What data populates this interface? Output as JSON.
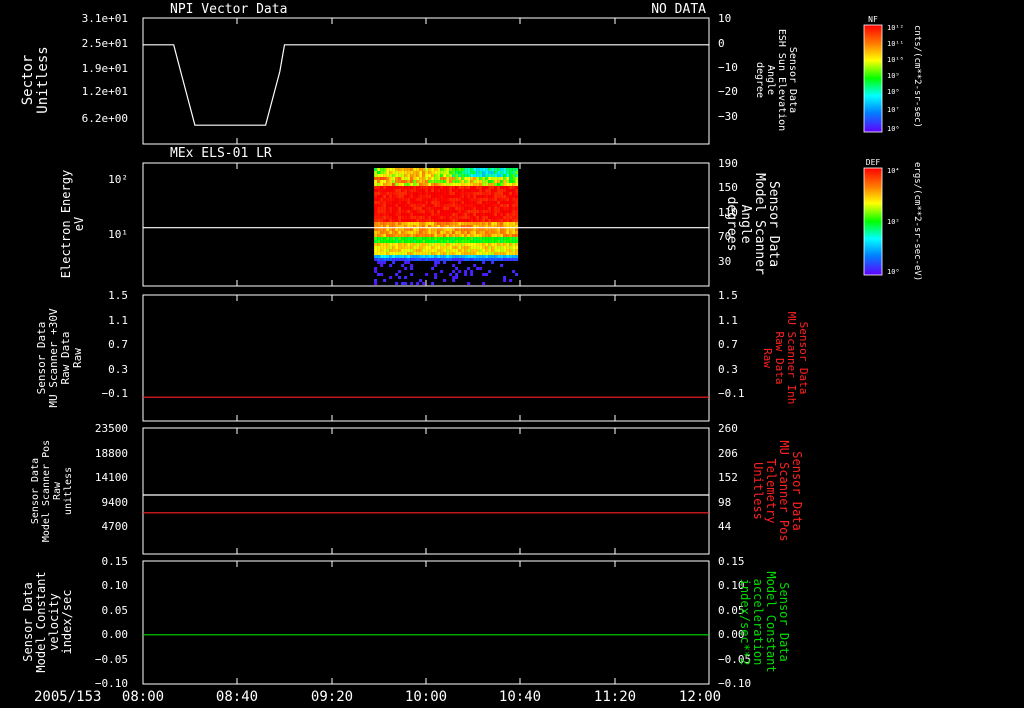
{
  "date_label": "2005/153",
  "x_ticks": [
    "08:00",
    "08:40",
    "09:20",
    "10:00",
    "10:40",
    "11:20",
    "12:00"
  ],
  "colors": {
    "axis": "#ffffff",
    "red": "#ff2020",
    "green": "#00dd00",
    "bg": "#000000"
  },
  "chart_data": [
    {
      "type": "line",
      "header_left": "NPI Vector Data",
      "header_right": "NO DATA",
      "left_label": [
        "Sector",
        "Unitless"
      ],
      "left_ticks": [
        "3.1e+01",
        "2.5e+01",
        "1.9e+01",
        "1.2e+01",
        "6.2e+00"
      ],
      "right_label": [
        "Sensor Data",
        "ESH Sun Elevation",
        "Angle",
        "degree"
      ],
      "right_ticks": [
        "10",
        "0",
        "−10",
        "−20",
        "−30"
      ],
      "right_ylim": [
        -37,
        10
      ],
      "series": [
        {
          "x": [
            "08:00",
            "08:13",
            "08:16",
            "08:22",
            "08:52",
            "08:58",
            "09:00",
            "12:00"
          ],
          "y": [
            0,
            0,
            -10,
            -30,
            -30,
            -10,
            0,
            0
          ]
        }
      ]
    },
    {
      "type": "heatmap",
      "header_left": "MEx ELS-01 LR",
      "left_label": [
        "Electron Energy",
        "eV"
      ],
      "left_ticks": [
        "10²",
        "10¹"
      ],
      "right_label": [
        "Sensor Data",
        "Model Scanner",
        "Angle",
        "degrees"
      ],
      "right_ticks": [
        "190",
        "150",
        "110",
        "70",
        "30"
      ],
      "right_ylim": [
        0,
        190
      ],
      "data_x_range": [
        "09:38",
        "10:38"
      ],
      "series": [
        {
          "x": [
            "08:00",
            "12:00"
          ],
          "y": [
            90,
            90
          ]
        }
      ]
    },
    {
      "type": "line",
      "left_label": [
        "Sensor Data",
        "MU Scanner +30V",
        "Raw Data",
        "Raw"
      ],
      "left_ticks": [
        "1.5",
        "1.1",
        "0.7",
        "0.3",
        "−0.1"
      ],
      "right_label": [
        "Sensor Data",
        "MU Scanner Inh",
        "Raw Data",
        "Raw"
      ],
      "right_ticks": [
        "1.5",
        "1.1",
        "0.7",
        "0.3",
        "−0.1"
      ],
      "ylim": [
        -0.35,
        1.5
      ],
      "series": [
        {
          "x": [
            "08:00",
            "12:00"
          ],
          "y": [
            0,
            0
          ]
        }
      ]
    },
    {
      "type": "line",
      "left_label": [
        "Sensor Data",
        "Model Scanner Pos",
        "Raw",
        "unitless"
      ],
      "left_ticks": [
        "23500",
        "18800",
        "14100",
        "9400",
        "4700"
      ],
      "right_label": [
        "Sensor Data",
        "MU Scanner Pos",
        "Telemetry",
        "Unitless"
      ],
      "right_ticks": [
        "260",
        "206",
        "152",
        "98",
        "44"
      ],
      "left_ylim": [
        0,
        23500
      ],
      "right_ylim": [
        0,
        260
      ],
      "series": [
        {
          "x": [
            "08:00",
            "12:00"
          ],
          "y": [
            11000,
            11000
          ]
        },
        {
          "x": [
            "08:00",
            "12:00"
          ],
          "y": [
            85,
            85
          ]
        }
      ]
    },
    {
      "type": "line",
      "left_label": [
        "Sensor Data",
        "Model Constant",
        "velocity",
        "index/sec"
      ],
      "left_ticks": [
        "0.15",
        "0.10",
        "0.05",
        "0.00",
        "−0.05",
        "−0.10"
      ],
      "right_label": [
        "Sensor Data",
        "Model Constant",
        "acceleration",
        "index/sec**2"
      ],
      "right_ticks": [
        "0.15",
        "0.10",
        "0.05",
        "0.00",
        "−0.05",
        "−0.10"
      ],
      "ylim": [
        -0.1,
        0.15
      ],
      "series": [
        {
          "x": [
            "08:00",
            "12:00"
          ],
          "y": [
            0,
            0
          ]
        }
      ]
    }
  ],
  "colorbars": [
    {
      "top": "NF",
      "ticks": [
        "10¹²",
        "10¹¹",
        "10¹⁰",
        "10⁹",
        "10⁸",
        "10⁷",
        "10⁶"
      ],
      "unit": "cnts/(cm**2-sr-sec)"
    },
    {
      "top": "DEF",
      "ticks": [
        "10⁴",
        "10²",
        "10⁰"
      ],
      "unit": "ergs/(cm**2-sr-sec-eV)"
    }
  ]
}
